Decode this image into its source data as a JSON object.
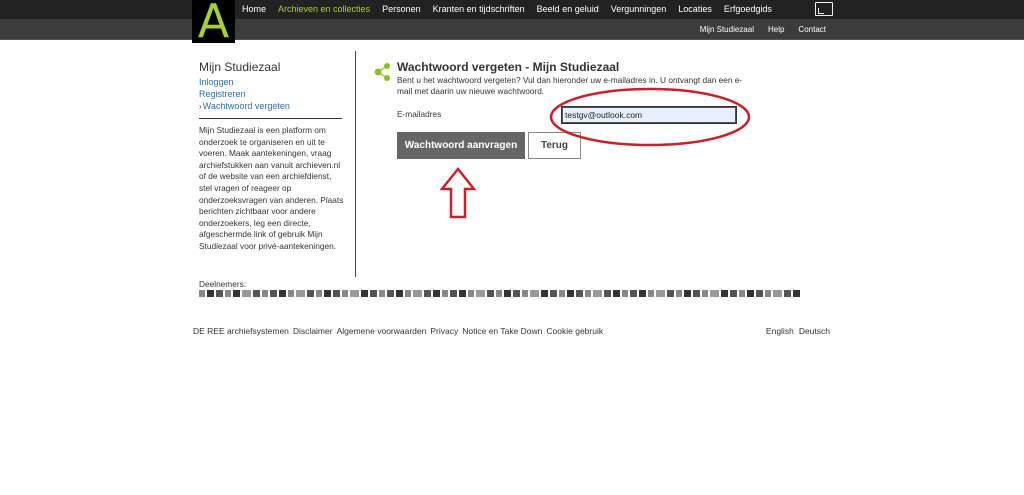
{
  "header": {
    "logo_letter": "A",
    "nav": [
      {
        "label": "Home"
      },
      {
        "label": "Archieven en collecties"
      },
      {
        "label": "Personen"
      },
      {
        "label": "Kranten en tijdschriften"
      },
      {
        "label": "Beeld en geluid"
      },
      {
        "label": "Vergunningen"
      },
      {
        "label": "Locaties"
      },
      {
        "label": "Erfgoedgids"
      }
    ],
    "active_nav": "Archieven en collecties",
    "subnav": [
      {
        "label": "Mijn Studiezaal"
      },
      {
        "label": "Help"
      },
      {
        "label": "Contact"
      }
    ],
    "screen_icon": "screen-icon"
  },
  "sidebar": {
    "title": "Mijn Studiezaal",
    "links": [
      {
        "label": "Inloggen"
      },
      {
        "label": "Registreren"
      },
      {
        "label": "Wachtwoord vergeten"
      }
    ],
    "current_marker": "›",
    "description": "Mijn Studiezaal is een platform om onderzoek te organiseren en uit te voeren. Maak aantekeningen, vraag archiefstukken aan vanuit archieven.nl of de website van een archiefdienst, stel vragen of reageer op onderzoeksvragen van anderen. Plaats berichten zichtbaar voor andere onderzoekers, leg een directe, afgeschermde link of gebruik Mijn Studiezaal voor privé-aantekeningen."
  },
  "main": {
    "title": "Wachtwoord vergeten - Mijn Studiezaal",
    "intro": "Bent u het wachtwoord vergeten? Vul dan hieronder uw e-mailadres in. U ontvangt dan een e-mail met daarin uw nieuwe wachtwoord.",
    "email_label": "E-mailadres",
    "email_value": "testgv@outlook.com",
    "submit_label": "Wachtwoord aanvragen",
    "back_label": "Terug"
  },
  "participants": {
    "label": "Deelnemers:"
  },
  "footer": {
    "links": [
      {
        "label": "DE REE archiefsystemen"
      },
      {
        "label": "Disclaimer"
      },
      {
        "label": "Algemene voorwaarden"
      },
      {
        "label": "Privacy"
      },
      {
        "label": "Notice en Take Down"
      },
      {
        "label": "Cookie gebruik"
      }
    ],
    "languages": [
      {
        "label": "English"
      },
      {
        "label": "Deutsch"
      }
    ]
  },
  "colors": {
    "accent": "#a6ce39",
    "link": "#2a6fa8",
    "annotation": "#cc1f2a"
  }
}
